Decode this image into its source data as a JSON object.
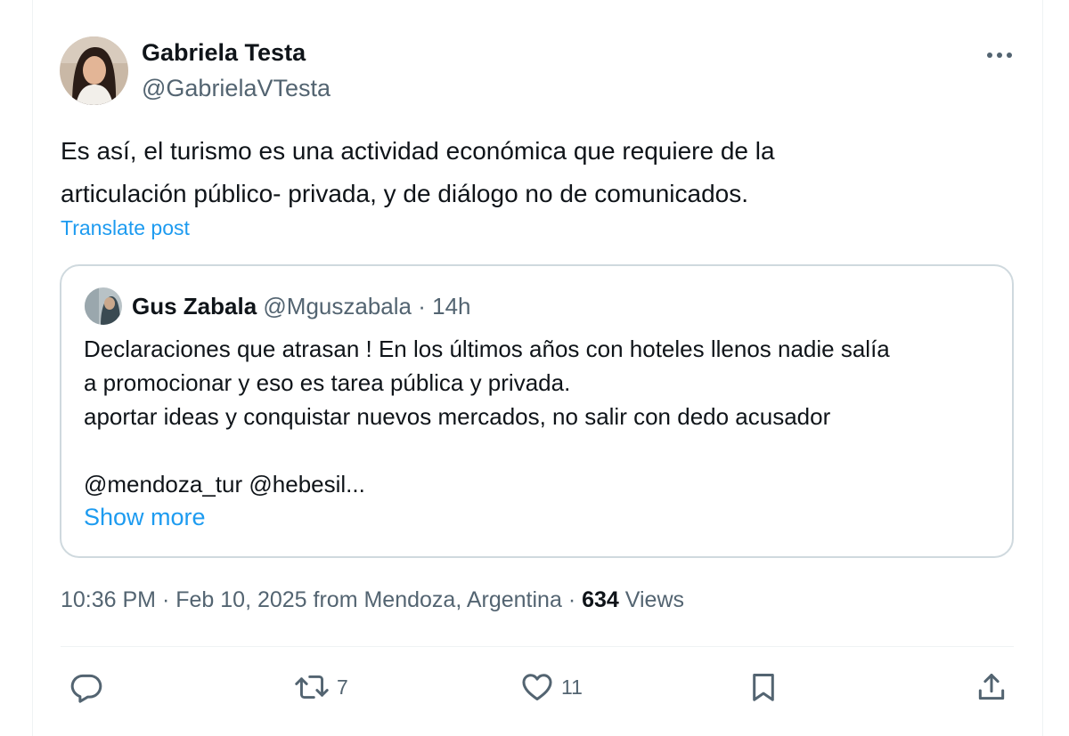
{
  "post": {
    "author_name": "Gabriela Testa",
    "author_handle": "@GabrielaVTesta",
    "text_lines": [
      "Es así, el turismo es una actividad económica que requiere de la",
      "articulación público- privada, y de diálogo no de comunicados."
    ],
    "translate_label": "Translate post",
    "more_icon": "more-horizontal-icon"
  },
  "quote": {
    "author_name": "Gus Zabala",
    "author_handle": "@Mguszabala",
    "separator": "·",
    "time": "14h",
    "text_lines": [
      "Declaraciones que atrasan ! En los últimos años con hoteles llenos nadie salía",
      "a promocionar y eso es tarea pública y privada.",
      "aportar ideas y conquistar nuevos mercados, no salir con dedo acusador",
      "",
      "@mendoza_tur @hebesil..."
    ],
    "show_more_label": "Show more"
  },
  "meta": {
    "time": "10:36 PM",
    "separator1": "·",
    "date_location": "Feb 10, 2025 from Mendoza, Argentina",
    "separator2": "·",
    "views_count": "634",
    "views_label": "Views"
  },
  "actions": {
    "reply": {
      "icon": "reply-icon"
    },
    "repost": {
      "icon": "repost-icon",
      "count": "7"
    },
    "like": {
      "icon": "heart-icon",
      "count": "11"
    },
    "bookmark": {
      "icon": "bookmark-icon"
    },
    "share": {
      "icon": "share-icon"
    }
  },
  "colors": {
    "text_primary": "#0f1419",
    "text_secondary": "#536471",
    "link": "#1d9bf0",
    "border": "#cfd9de"
  }
}
